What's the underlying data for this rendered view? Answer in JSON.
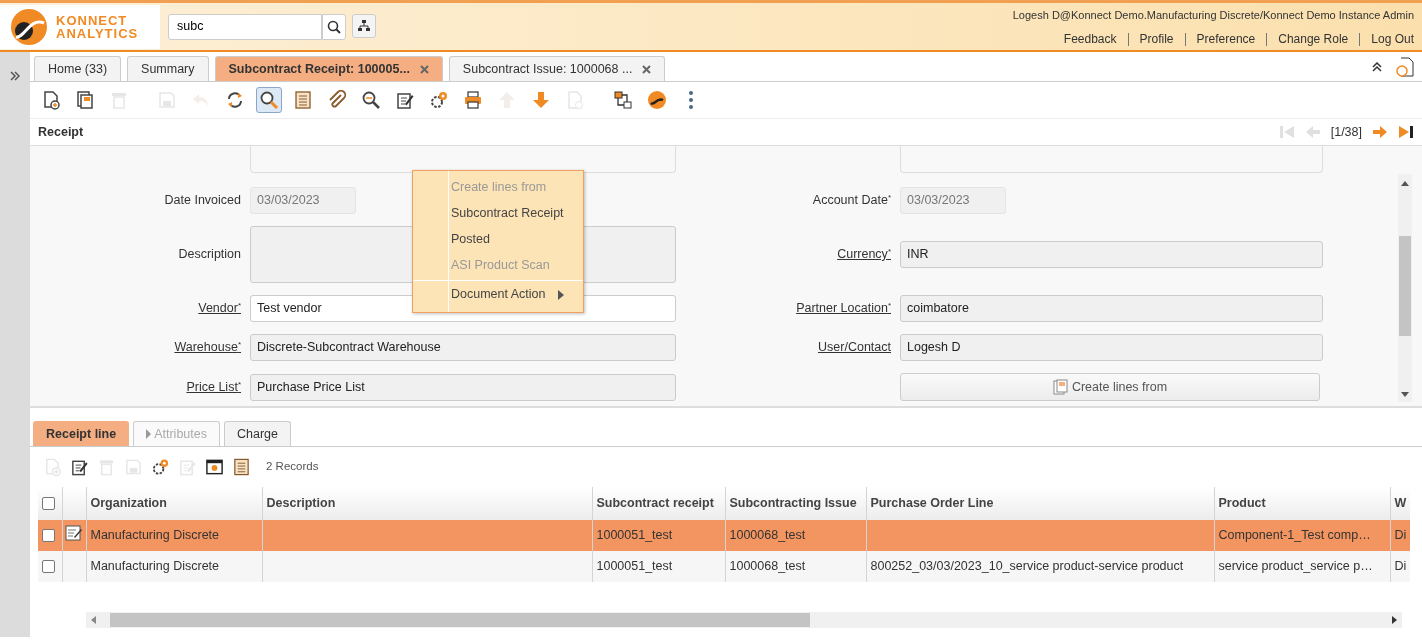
{
  "header": {
    "logo_line_1": "KONNECT",
    "logo_line_2": "ANALYTICS",
    "search": {
      "value": "subc"
    },
    "user": "Logesh D@Konnect Demo.Manufacturing Discrete/Konnect Demo Instance Admin",
    "links": [
      "Feedback",
      "Profile",
      "Preference",
      "Change Role",
      "Log Out"
    ]
  },
  "tabs": [
    {
      "label": "Home (33)",
      "selected": false,
      "closable": false
    },
    {
      "label": "Summary",
      "selected": false,
      "closable": false
    },
    {
      "label": "Subcontract Receipt: 100005...",
      "selected": true,
      "closable": true
    },
    {
      "label": "Subcontract Issue: 1000068 ...",
      "selected": false,
      "closable": true
    }
  ],
  "toolbar": [
    [
      {
        "kind": "new",
        "disabled": false
      },
      {
        "kind": "copy",
        "disabled": false
      },
      {
        "kind": "delete",
        "disabled": true
      }
    ],
    [
      {
        "kind": "save",
        "disabled": true
      },
      {
        "kind": "undo",
        "disabled": true
      },
      {
        "kind": "refresh",
        "disabled": false
      },
      {
        "kind": "find",
        "disabled": false,
        "pressed": true
      },
      {
        "kind": "grid",
        "disabled": false
      },
      {
        "kind": "attach",
        "disabled": false
      },
      {
        "kind": "zoom",
        "disabled": false
      },
      {
        "kind": "note",
        "disabled": false
      },
      {
        "kind": "process",
        "disabled": false
      },
      {
        "kind": "print",
        "disabled": false
      },
      {
        "kind": "up",
        "disabled": true
      },
      {
        "kind": "down",
        "disabled": false
      },
      {
        "kind": "doc",
        "disabled": true
      }
    ],
    [
      {
        "kind": "workflow",
        "disabled": false
      },
      {
        "kind": "logo",
        "disabled": false
      },
      {
        "kind": "more",
        "disabled": false
      }
    ]
  ],
  "panel": {
    "title": "Receipt",
    "pager": "[1/38]",
    "first_disabled": true,
    "prev_disabled": true,
    "next_disabled": false,
    "last_disabled": false
  },
  "menu": {
    "items": [
      {
        "label": "Create lines from",
        "disabled": true
      },
      {
        "label": "Subcontract Receipt",
        "disabled": false
      },
      {
        "label": "Posted",
        "disabled": false
      },
      {
        "label": "ASI Product Scan",
        "disabled": true
      },
      {
        "label": "Document Action",
        "disabled": false,
        "submenu": true,
        "separator_before": true
      }
    ]
  },
  "form": {
    "rows": [
      [
        {
          "kind": "date",
          "label": "Date Invoiced",
          "value": "03/03/2023",
          "link": false,
          "readonly": true
        },
        {
          "kind": "date",
          "label": "Account Date$^{*}$",
          "value": "03/03/2023",
          "link": false,
          "readonly": true
        }
      ],
      [
        {
          "kind": "textarea",
          "label": "Description",
          "link": false,
          "readonly": true
        },
        {
          "kind": "text",
          "label": "Currency$^{*}$",
          "value": "INR",
          "link": true,
          "readonly": true
        }
      ],
      [
        {
          "kind": "text",
          "label": "Vendor$^{*}$",
          "value": "Test vendor",
          "link": true,
          "readonly": false
        },
        {
          "kind": "text",
          "label": "Partner Location$^{*}$",
          "value": "coimbatore",
          "link": true,
          "readonly": true
        }
      ],
      [
        {
          "kind": "text",
          "label": "Warehouse$^{*}$",
          "value": "Discrete-Subcontract Warehouse",
          "link": true,
          "readonly": true
        },
        {
          "kind": "text",
          "label": "User/Contact",
          "value": "Logesh D",
          "link": true,
          "readonly": true
        }
      ],
      [
        {
          "kind": "text",
          "label": "Price List$^{*}$",
          "value": "Purchase Price List",
          "link": true,
          "readonly": true
        },
        {
          "kind": "button",
          "label": "Create lines from"
        }
      ]
    ]
  },
  "detail_tabs": [
    {
      "label": "Receipt line",
      "selected": true,
      "disabled": false
    },
    {
      "label": "Attributes",
      "selected": false,
      "disabled": true,
      "expander": true
    },
    {
      "label": "Charge",
      "selected": false,
      "disabled": false
    }
  ],
  "detail_toolbar": [
    {
      "kind": "new",
      "disabled": true
    },
    {
      "kind": "note",
      "disabled": false
    },
    {
      "kind": "delete",
      "disabled": true
    },
    {
      "kind": "save",
      "disabled": true
    },
    {
      "kind": "process",
      "disabled": false
    },
    {
      "kind": "note",
      "disabled": true
    },
    {
      "kind": "window",
      "disabled": false
    },
    {
      "kind": "grid",
      "disabled": false
    }
  ],
  "record_count": "2 Records",
  "grid": {
    "select_all_checked": false,
    "columns": [
      "Organization",
      "Description",
      "Subcontract receipt",
      "Subcontracting Issue",
      "Purchase Order Line",
      "Product",
      "W"
    ],
    "rows": [
      {
        "selected": true,
        "editing": true,
        "checked": false,
        "cells": [
          "Manufacturing Discrete",
          "",
          "1000051_test",
          "1000068_test",
          "",
          "Component-1_Test comp…",
          "Di"
        ]
      },
      {
        "selected": false,
        "editing": false,
        "checked": false,
        "cells": [
          "Manufacturing Discrete",
          "",
          "1000051_test",
          "1000068_test",
          "800252_03/03/2023_10_service product-service product",
          "service product_service p…",
          "Di"
        ]
      }
    ]
  }
}
